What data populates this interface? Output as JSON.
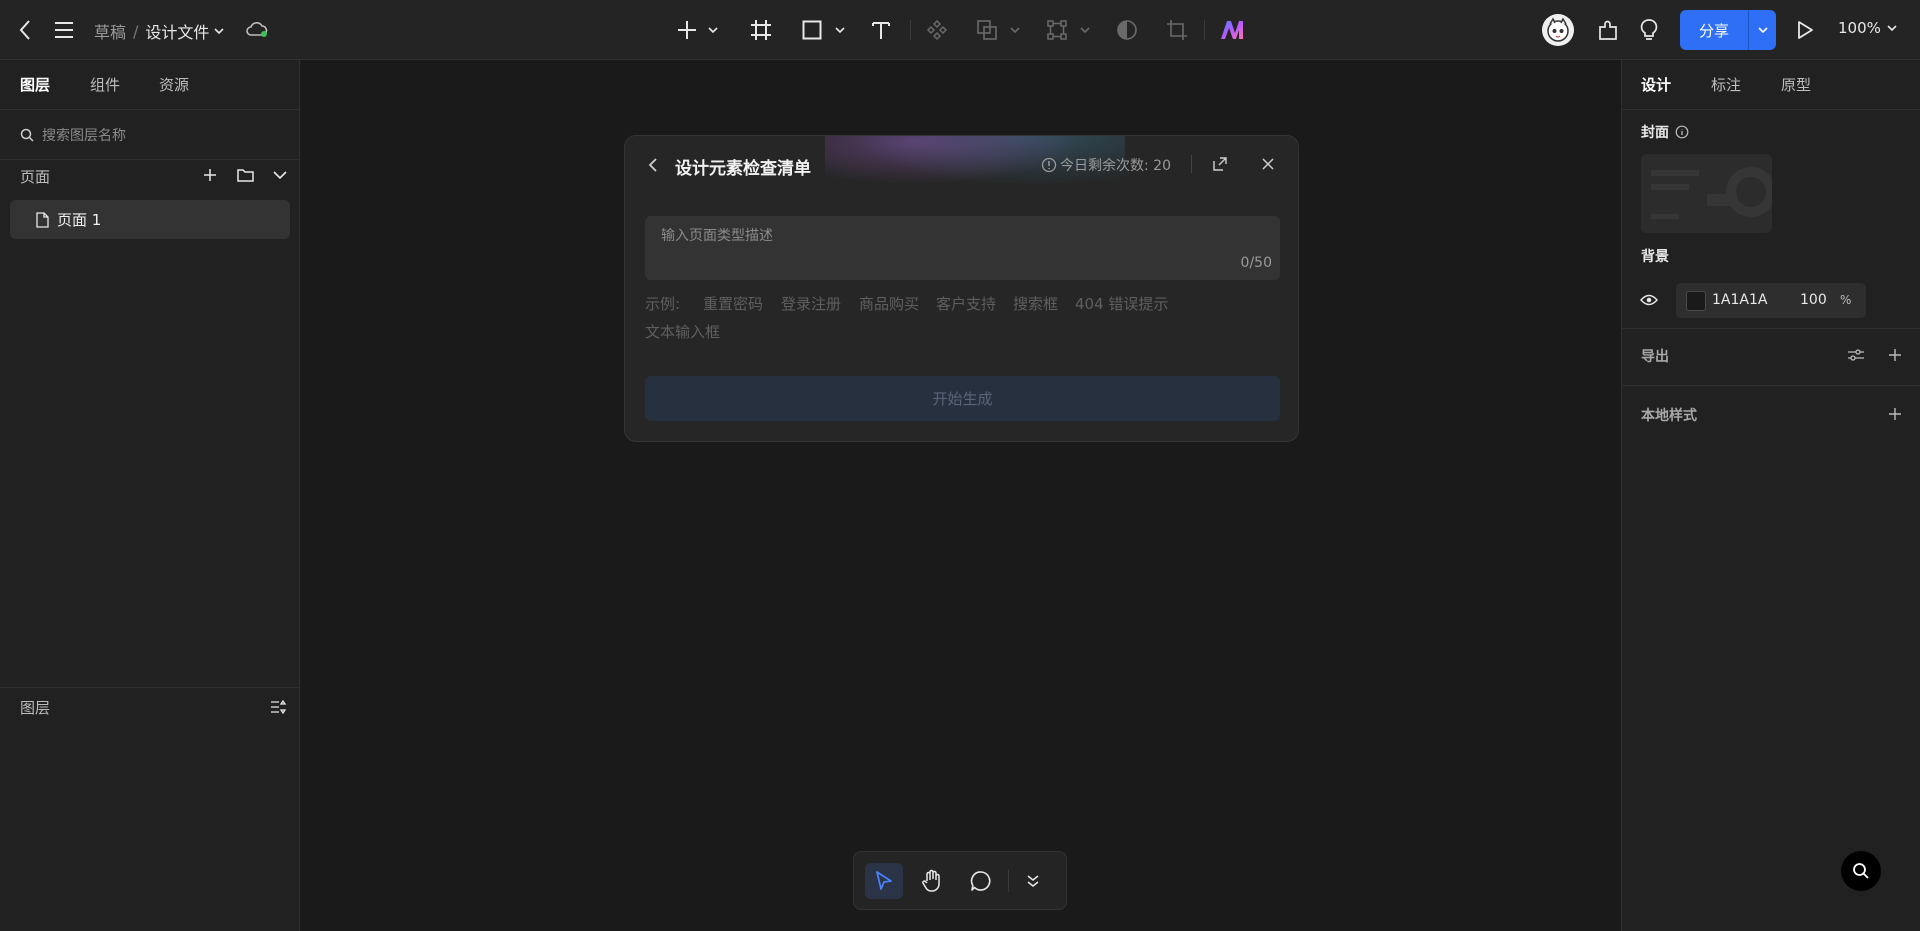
{
  "toolbar": {
    "breadcrumb_parent": "草稿",
    "breadcrumb_sep": "/",
    "file_name": "设计文件",
    "share_label": "分享",
    "zoom": "100%"
  },
  "left_panel": {
    "tabs": [
      "图层",
      "组件",
      "资源"
    ],
    "search_placeholder": "搜索图层名称",
    "pages_label": "页面",
    "pages": [
      {
        "label": "页面 1"
      }
    ],
    "layers_label": "图层"
  },
  "dialog": {
    "title": "设计元素检查清单",
    "quota": "今日剩余次数: 20",
    "input_placeholder": "输入页面类型描述",
    "char_count": "0/50",
    "examples_label": "示例:",
    "examples": [
      "重置密码",
      "登录注册",
      "商品购买",
      "客户支持",
      "搜索框",
      "404 错误提示",
      "文本输入框"
    ],
    "generate_label": "开始生成"
  },
  "right_panel": {
    "tabs": [
      "设计",
      "标注",
      "原型"
    ],
    "cover_label": "封面",
    "background_label": "背景",
    "bg_color": "1A1A1A",
    "bg_opacity": "100",
    "bg_opacity_unit": "%",
    "export_label": "导出",
    "local_styles_label": "本地样式"
  },
  "colors": {
    "accent": "#2f6ff5",
    "background": "#1a1a1a"
  }
}
